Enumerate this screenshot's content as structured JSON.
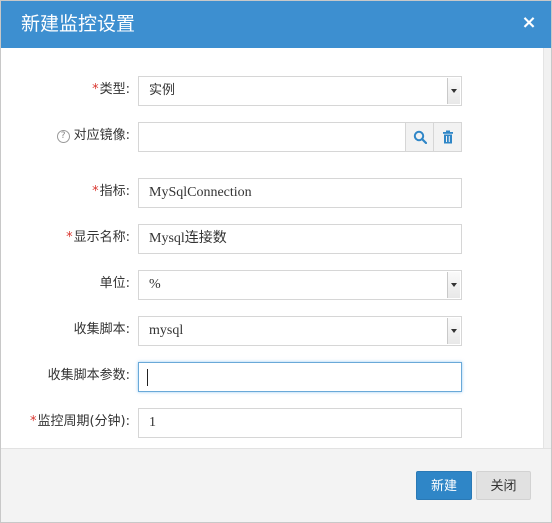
{
  "dialog": {
    "title": "新建监控设置",
    "close_label": "×"
  },
  "form": {
    "type": {
      "label": "类型:",
      "required": true,
      "value": "实例"
    },
    "mirror": {
      "label": "对应镜像:",
      "required": false,
      "help_icon": "question-circle-icon",
      "value": "",
      "search_icon": "search-icon",
      "delete_icon": "trash-icon"
    },
    "metric": {
      "label": "指标:",
      "required": true,
      "value": "MySqlConnection"
    },
    "display_name": {
      "label": "显示名称:",
      "required": true,
      "value": "Mysql连接数"
    },
    "unit": {
      "label": "单位:",
      "required": false,
      "value": "%"
    },
    "script": {
      "label": "收集脚本:",
      "required": false,
      "value": "mysql"
    },
    "script_params": {
      "label": "收集脚本参数:",
      "required": false,
      "value": ""
    },
    "period": {
      "label": "监控周期(分钟):",
      "required": true,
      "value": "1"
    }
  },
  "footer": {
    "create_label": "新建",
    "close_label": "关闭"
  },
  "colors": {
    "header_bg": "#3d8fd0",
    "primary_button": "#2f86c7",
    "required_star": "#d9352e"
  }
}
